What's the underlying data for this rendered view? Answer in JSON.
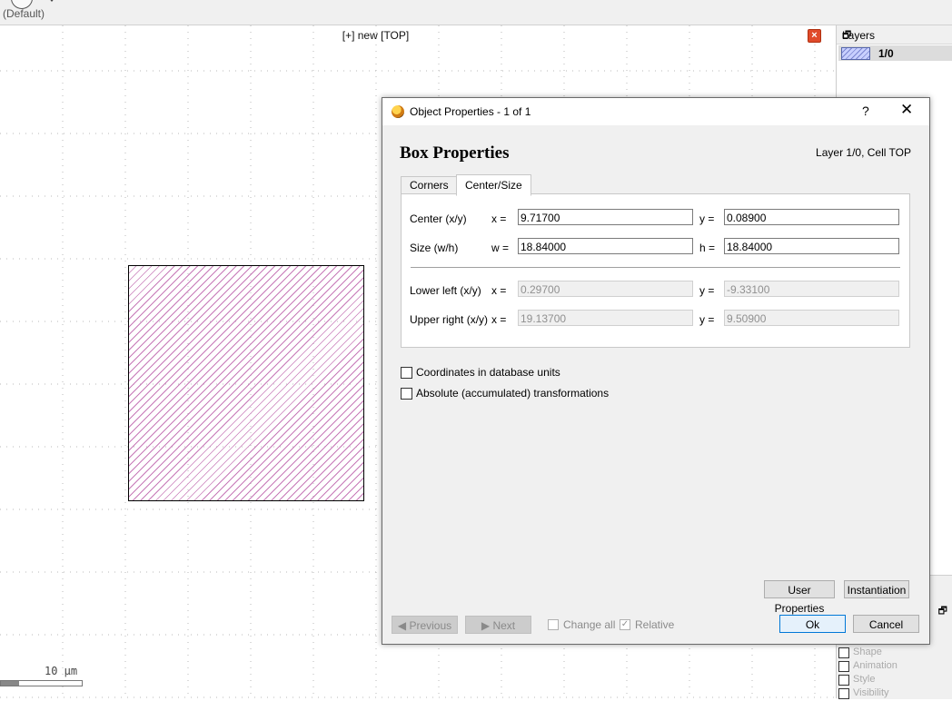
{
  "toolbar": {
    "default_label": "(Default)"
  },
  "canvas": {
    "title": "[+] new [TOP]",
    "scale_label": "10 µm",
    "shape_fill_color": "#c77ab8"
  },
  "layers_panel": {
    "title": "Layers",
    "layers": [
      {
        "name": "1/0"
      }
    ],
    "lower_items": [
      "Shape",
      "Animation",
      "Style",
      "Visibility"
    ]
  },
  "dialog": {
    "title": "Object Properties - 1 of 1",
    "help": "?",
    "heading": "Box Properties",
    "layer_info": "Layer 1/0, Cell TOP",
    "tabs": [
      {
        "label": "Corners",
        "active": false
      },
      {
        "label": "Center/Size",
        "active": true
      }
    ],
    "fields": {
      "center_label": "Center (x/y)",
      "center_x_label": "x =",
      "center_x": "9.71700",
      "center_y_label": "y =",
      "center_y": "0.08900",
      "size_label": "Size (w/h)",
      "size_w_label": "w =",
      "size_w": "18.84000",
      "size_h_label": "h =",
      "size_h": "18.84000",
      "lower_left_label": "Lower left (x/y)",
      "ll_x_label": "x =",
      "ll_x": "0.29700",
      "ll_y_label": "y =",
      "ll_y": "-9.33100",
      "upper_right_label": "Upper right (x/y)",
      "ur_x_label": "x =",
      "ur_x": "19.13700",
      "ur_y_label": "y =",
      "ur_y": "9.50900"
    },
    "checks": {
      "db_units": "Coordinates in database units",
      "absolute": "Absolute (accumulated) transformations"
    },
    "buttons": {
      "user_properties": "User Properties",
      "instantiation": "Instantiation",
      "previous": "Previous",
      "next": "Next",
      "change_all": "Change all",
      "relative": "Relative",
      "ok": "Ok",
      "cancel": "Cancel"
    }
  }
}
